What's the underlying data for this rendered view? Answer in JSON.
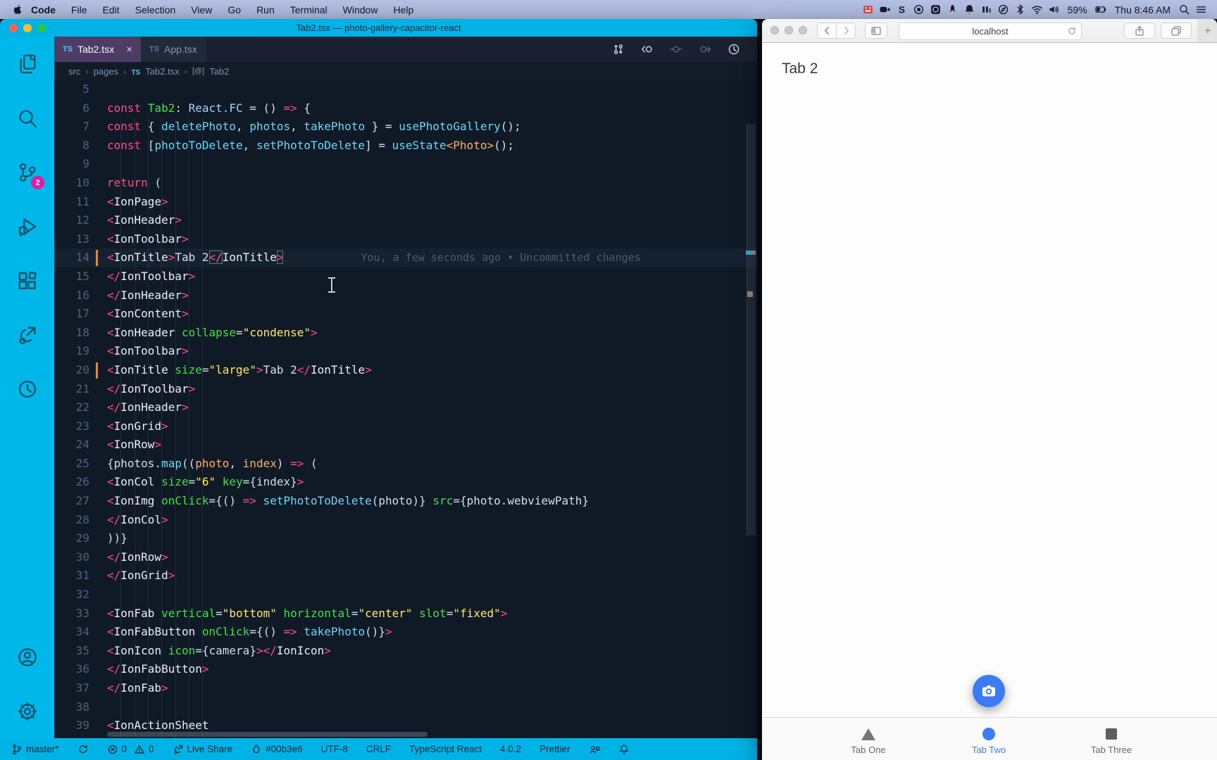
{
  "menubar": {
    "apple_icon": "apple-icon",
    "items": [
      "Code",
      "File",
      "Edit",
      "Selection",
      "View",
      "Go",
      "Run",
      "Terminal",
      "Window",
      "Help"
    ],
    "active_app": "Code",
    "status_icons": [
      "film-icon",
      "videocam-icon",
      "s-icon",
      "record-icon",
      "screenrec-icon",
      "rocket-icon",
      "bell-icon",
      "pause-icon",
      "compass-icon",
      "bluetooth-icon",
      "wifi-icon",
      "volume-icon"
    ],
    "battery": "59%",
    "clock": "Thu 8:46 AM",
    "right_glyphs": [
      "search-icon",
      "list-icon"
    ]
  },
  "vscode": {
    "title": "Tab2.tsx — photo-gallery-capacitor-react",
    "traffic_colors": [
      "#ff5f57",
      "#febc2e",
      "#2ac840"
    ],
    "tabs": [
      {
        "icon": "TS",
        "label": "Tab2.tsx",
        "active": true,
        "close": "×"
      },
      {
        "icon": "TS",
        "label": "App.tsx",
        "active": false
      }
    ],
    "actions": [
      {
        "icon": "compare",
        "dim": false
      },
      {
        "icon": "backc",
        "dim": false
      },
      {
        "icon": "centerc",
        "dim": true
      },
      {
        "icon": "fwdc",
        "dim": true
      },
      {
        "icon": "timeline",
        "dim": false
      }
    ],
    "breadcrumb": [
      "src",
      "pages",
      "Tab2.tsx",
      "Tab2"
    ],
    "activity": [
      {
        "name": "explorer",
        "icon": "files"
      },
      {
        "name": "search",
        "icon": "search"
      },
      {
        "name": "source-control",
        "icon": "branch",
        "badge": "2"
      },
      {
        "name": "run-debug",
        "icon": "debug"
      },
      {
        "name": "extensions",
        "icon": "extensions"
      },
      {
        "name": "live-share",
        "icon": "liveshare"
      },
      {
        "name": "timeline",
        "icon": "timeline"
      }
    ],
    "activity_bottom": [
      {
        "name": "accounts",
        "icon": "account"
      },
      {
        "name": "settings",
        "icon": "gear"
      }
    ],
    "blame": "You, a few seconds ago • Uncommitted changes",
    "code_lines": [
      {
        "n": 5,
        "t": []
      },
      {
        "n": 6,
        "t": [
          [
            "p",
            "const "
          ],
          [
            "g",
            "Tab2"
          ],
          [
            "w",
            ": "
          ],
          [
            "bl",
            "React.FC"
          ],
          [
            "w",
            " = () "
          ],
          [
            "p",
            "=>"
          ],
          [
            "w",
            " {"
          ]
        ]
      },
      {
        "n": 7,
        "t": [
          [
            "w",
            "  "
          ],
          [
            "p",
            "const"
          ],
          [
            "w",
            " { "
          ],
          [
            "c",
            "deletePhoto"
          ],
          [
            "w",
            ", "
          ],
          [
            "c",
            "photos"
          ],
          [
            "w",
            ", "
          ],
          [
            "c",
            "takePhoto"
          ],
          [
            "w",
            " } = "
          ],
          [
            "c",
            "usePhotoGallery"
          ],
          [
            "w",
            "();"
          ]
        ]
      },
      {
        "n": 8,
        "t": [
          [
            "w",
            "  "
          ],
          [
            "p",
            "const"
          ],
          [
            "w",
            " ["
          ],
          [
            "c",
            "photoToDelete"
          ],
          [
            "w",
            ", "
          ],
          [
            "c",
            "setPhotoToDelete"
          ],
          [
            "w",
            "] = "
          ],
          [
            "c",
            "useState"
          ],
          [
            "o",
            "<Photo>"
          ],
          [
            "w",
            "();"
          ]
        ]
      },
      {
        "n": 9,
        "t": []
      },
      {
        "n": 10,
        "t": [
          [
            "w",
            "  "
          ],
          [
            "p",
            "return"
          ],
          [
            "w",
            " ("
          ]
        ]
      },
      {
        "n": 11,
        "t": [
          [
            "w",
            "    "
          ],
          [
            "p",
            "<"
          ],
          [
            "tg",
            "IonPage"
          ],
          [
            "p",
            ">"
          ]
        ]
      },
      {
        "n": 12,
        "t": [
          [
            "w",
            "      "
          ],
          [
            "p",
            "<"
          ],
          [
            "tg",
            "IonHeader"
          ],
          [
            "p",
            ">"
          ]
        ]
      },
      {
        "n": 13,
        "t": [
          [
            "w",
            "        "
          ],
          [
            "p",
            "<"
          ],
          [
            "tg",
            "IonToolbar"
          ],
          [
            "p",
            ">"
          ]
        ]
      },
      {
        "n": 14,
        "current": true,
        "marker": true,
        "blame": true,
        "t": [
          [
            "w",
            "          "
          ],
          [
            "p",
            "<"
          ],
          [
            "tg",
            "IonTitle"
          ],
          [
            "p",
            ">"
          ],
          [
            "w",
            "Tab 2"
          ],
          [
            "p bx",
            "</"
          ],
          [
            "tg",
            "IonTitle"
          ],
          [
            "p bx",
            ">"
          ]
        ]
      },
      {
        "n": 15,
        "t": [
          [
            "w",
            "        "
          ],
          [
            "p",
            "</"
          ],
          [
            "tg",
            "IonToolbar"
          ],
          [
            "p",
            ">"
          ]
        ]
      },
      {
        "n": 16,
        "t": [
          [
            "w",
            "      "
          ],
          [
            "p",
            "</"
          ],
          [
            "tg",
            "IonHeader"
          ],
          [
            "p",
            ">"
          ]
        ]
      },
      {
        "n": 17,
        "t": [
          [
            "w",
            "      "
          ],
          [
            "p",
            "<"
          ],
          [
            "tg",
            "IonContent"
          ],
          [
            "p",
            ">"
          ]
        ]
      },
      {
        "n": 18,
        "t": [
          [
            "w",
            "        "
          ],
          [
            "p",
            "<"
          ],
          [
            "tg",
            "IonHeader"
          ],
          [
            "w",
            " "
          ],
          [
            "g",
            "collapse"
          ],
          [
            "w",
            "="
          ],
          [
            "y",
            "\"condense\""
          ],
          [
            "p",
            ">"
          ]
        ]
      },
      {
        "n": 19,
        "t": [
          [
            "w",
            "          "
          ],
          [
            "p",
            "<"
          ],
          [
            "tg",
            "IonToolbar"
          ],
          [
            "p",
            ">"
          ]
        ]
      },
      {
        "n": 20,
        "marker": true,
        "t": [
          [
            "w",
            "            "
          ],
          [
            "p",
            "<"
          ],
          [
            "tg",
            "IonTitle"
          ],
          [
            "w",
            " "
          ],
          [
            "g",
            "size"
          ],
          [
            "w",
            "="
          ],
          [
            "y",
            "\"large\""
          ],
          [
            "p",
            ">"
          ],
          [
            "w",
            "Tab 2"
          ],
          [
            "p",
            "</"
          ],
          [
            "tg",
            "IonTitle"
          ],
          [
            "p",
            ">"
          ]
        ]
      },
      {
        "n": 21,
        "t": [
          [
            "w",
            "          "
          ],
          [
            "p",
            "</"
          ],
          [
            "tg",
            "IonToolbar"
          ],
          [
            "p",
            ">"
          ]
        ]
      },
      {
        "n": 22,
        "t": [
          [
            "w",
            "        "
          ],
          [
            "p",
            "</"
          ],
          [
            "tg",
            "IonHeader"
          ],
          [
            "p",
            ">"
          ]
        ]
      },
      {
        "n": 23,
        "t": [
          [
            "w",
            "        "
          ],
          [
            "p",
            "<"
          ],
          [
            "tg",
            "IonGrid"
          ],
          [
            "p",
            ">"
          ]
        ]
      },
      {
        "n": 24,
        "t": [
          [
            "w",
            "          "
          ],
          [
            "p",
            "<"
          ],
          [
            "tg",
            "IonRow"
          ],
          [
            "p",
            ">"
          ]
        ]
      },
      {
        "n": 25,
        "t": [
          [
            "w",
            "            {photos."
          ],
          [
            "c",
            "map"
          ],
          [
            "w",
            "(("
          ],
          [
            "o",
            "photo"
          ],
          [
            "w",
            ", "
          ],
          [
            "o",
            "index"
          ],
          [
            "w",
            ") "
          ],
          [
            "p",
            "=>"
          ],
          [
            "w",
            " ("
          ]
        ]
      },
      {
        "n": 26,
        "t": [
          [
            "w",
            "              "
          ],
          [
            "p",
            "<"
          ],
          [
            "tg",
            "IonCol"
          ],
          [
            "w",
            " "
          ],
          [
            "g",
            "size"
          ],
          [
            "w",
            "="
          ],
          [
            "y",
            "\"6\""
          ],
          [
            "w",
            " "
          ],
          [
            "g",
            "key"
          ],
          [
            "w",
            "={index}"
          ],
          [
            "p",
            ">"
          ]
        ]
      },
      {
        "n": 27,
        "t": [
          [
            "w",
            "                "
          ],
          [
            "p",
            "<"
          ],
          [
            "tg",
            "IonImg"
          ],
          [
            "w",
            " "
          ],
          [
            "g",
            "onClick"
          ],
          [
            "w",
            "={() "
          ],
          [
            "p",
            "=>"
          ],
          [
            "w",
            " "
          ],
          [
            "c",
            "setPhotoToDelete"
          ],
          [
            "w",
            "(photo)} "
          ],
          [
            "g",
            "src"
          ],
          [
            "w",
            "={photo.webviewPath}"
          ]
        ]
      },
      {
        "n": 28,
        "t": [
          [
            "w",
            "              "
          ],
          [
            "p",
            "</"
          ],
          [
            "tg",
            "IonCol"
          ],
          [
            "p",
            ">"
          ]
        ]
      },
      {
        "n": 29,
        "t": [
          [
            "w",
            "            ))}"
          ]
        ]
      },
      {
        "n": 30,
        "t": [
          [
            "w",
            "          "
          ],
          [
            "p",
            "</"
          ],
          [
            "tg",
            "IonRow"
          ],
          [
            "p",
            ">"
          ]
        ]
      },
      {
        "n": 31,
        "t": [
          [
            "w",
            "        "
          ],
          [
            "p",
            "</"
          ],
          [
            "tg",
            "IonGrid"
          ],
          [
            "p",
            ">"
          ]
        ]
      },
      {
        "n": 32,
        "t": []
      },
      {
        "n": 33,
        "t": [
          [
            "w",
            "        "
          ],
          [
            "p",
            "<"
          ],
          [
            "tg",
            "IonFab"
          ],
          [
            "w",
            " "
          ],
          [
            "g",
            "vertical"
          ],
          [
            "w",
            "="
          ],
          [
            "y",
            "\"bottom\""
          ],
          [
            "w",
            " "
          ],
          [
            "g",
            "horizontal"
          ],
          [
            "w",
            "="
          ],
          [
            "y",
            "\"center\""
          ],
          [
            "w",
            " "
          ],
          [
            "g",
            "slot"
          ],
          [
            "w",
            "="
          ],
          [
            "y",
            "\"fixed\""
          ],
          [
            "p",
            ">"
          ]
        ]
      },
      {
        "n": 34,
        "t": [
          [
            "w",
            "          "
          ],
          [
            "p",
            "<"
          ],
          [
            "tg",
            "IonFabButton"
          ],
          [
            "w",
            " "
          ],
          [
            "g",
            "onClick"
          ],
          [
            "w",
            "={() "
          ],
          [
            "p",
            "=>"
          ],
          [
            "w",
            " "
          ],
          [
            "c",
            "takePhoto"
          ],
          [
            "w",
            "()}"
          ],
          [
            "p",
            ">"
          ]
        ]
      },
      {
        "n": 35,
        "t": [
          [
            "w",
            "            "
          ],
          [
            "p",
            "<"
          ],
          [
            "tg",
            "IonIcon"
          ],
          [
            "w",
            " "
          ],
          [
            "g",
            "icon"
          ],
          [
            "w",
            "={camera}"
          ],
          [
            "p",
            "></"
          ],
          [
            "tg",
            "IonIcon"
          ],
          [
            "p",
            ">"
          ]
        ]
      },
      {
        "n": 36,
        "t": [
          [
            "w",
            "          "
          ],
          [
            "p",
            "</"
          ],
          [
            "tg",
            "IonFabButton"
          ],
          [
            "p",
            ">"
          ]
        ]
      },
      {
        "n": 37,
        "t": [
          [
            "w",
            "        "
          ],
          [
            "p",
            "</"
          ],
          [
            "tg",
            "IonFab"
          ],
          [
            "p",
            ">"
          ]
        ]
      },
      {
        "n": 38,
        "t": []
      },
      {
        "n": 39,
        "t": [
          [
            "w",
            "        "
          ],
          [
            "p",
            "<"
          ],
          [
            "tg",
            "IonActionSheet"
          ]
        ]
      }
    ],
    "status_items": [
      {
        "icon": "branch",
        "label": "master*",
        "name": "branch"
      },
      {
        "icon": "sync",
        "label": "",
        "name": "sync"
      },
      {
        "icon": "errorx",
        "label": "0",
        "name": "errors"
      },
      {
        "icon": "warn",
        "label": "0",
        "name": "warnings",
        "tight": true
      },
      {
        "icon": "lsarrow",
        "label": "Live Share",
        "name": "live-share"
      },
      {
        "icon": "ink",
        "label": "#00b3e6",
        "name": "color-theme"
      },
      {
        "icon": "",
        "label": "UTF-8",
        "name": "encoding"
      },
      {
        "icon": "",
        "label": "CRLF",
        "name": "eol"
      },
      {
        "icon": "",
        "label": "TypeScript React",
        "name": "language"
      },
      {
        "icon": "",
        "label": "4.0.2",
        "name": "ts-version"
      },
      {
        "icon": "",
        "label": "Prettier",
        "name": "formatter"
      },
      {
        "icon": "feedback",
        "label": "",
        "name": "feedback"
      },
      {
        "icon": "bell",
        "label": "",
        "name": "notifications"
      }
    ],
    "accent": "#00b3e6"
  },
  "safari": {
    "url": "localhost",
    "page_title": "Tab 2",
    "fab_color": "#3b7bf5",
    "tab_active_color": "#3d7ef7",
    "tabs": [
      {
        "label": "Tab One",
        "shape": "triangle",
        "active": false
      },
      {
        "label": "Tab Two",
        "shape": "circle",
        "active": true
      },
      {
        "label": "Tab Three",
        "shape": "square",
        "active": false
      }
    ],
    "plus": "+"
  }
}
